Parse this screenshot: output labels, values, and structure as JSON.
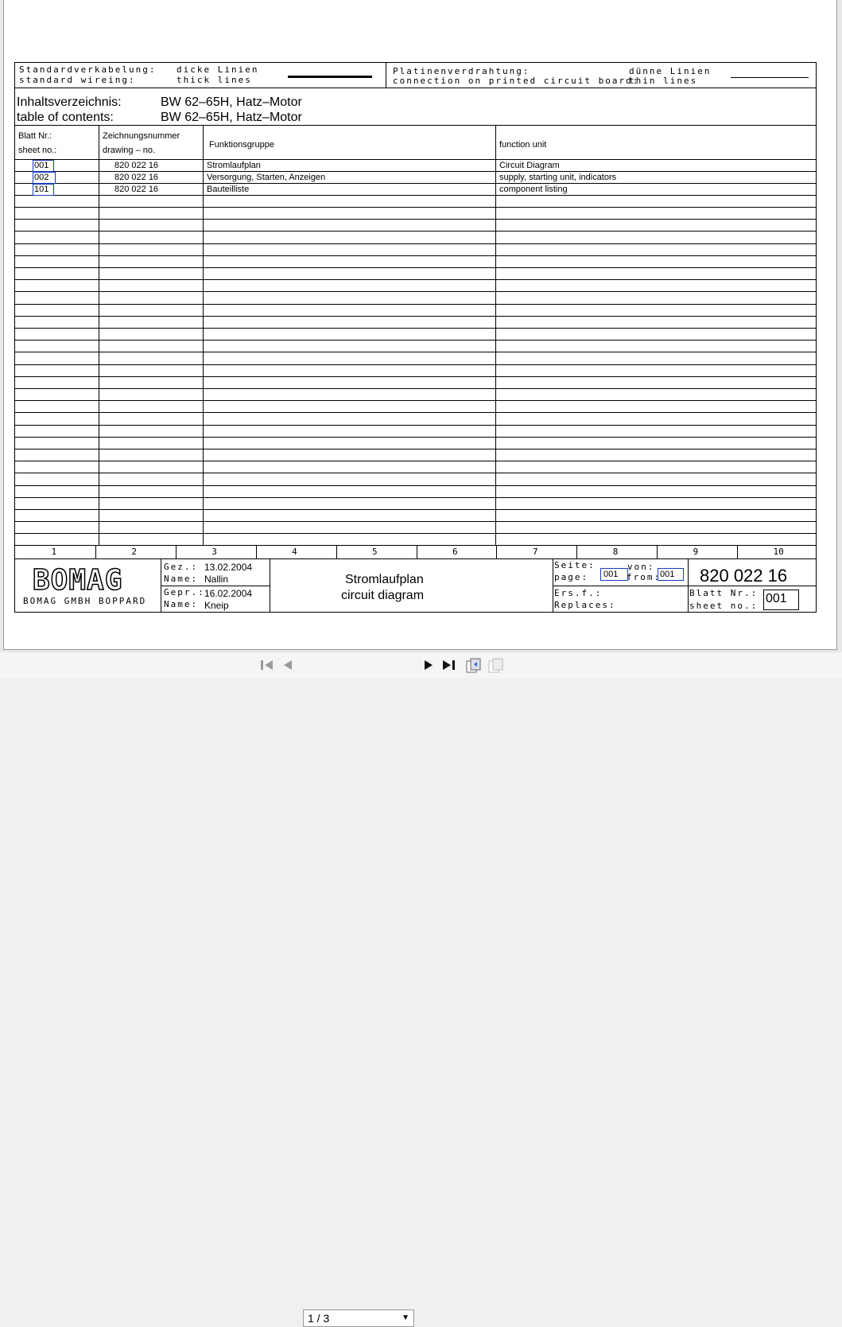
{
  "legend": {
    "std_de": "Standardverkabelung:",
    "std_en": "standard wireing:",
    "thick_de": "dicke Linien",
    "thick_en": "thick lines",
    "pcb_de": "Platinenverdrahtung:",
    "pcb_en": "connection on printed circuit board:",
    "thin_de": "dünne Linien",
    "thin_en": "thin lines"
  },
  "contents": {
    "label_de": "Inhaltsverzeichnis:",
    "label_en": "table of contents:",
    "title_de": "BW 62–65H, Hatz–Motor",
    "title_en": "BW 62–65H, Hatz–Motor"
  },
  "table": {
    "h_sheet_de": "Blatt Nr.:",
    "h_sheet_en": "sheet no.:",
    "h_drawing_de": "Zeichnungsnummer",
    "h_drawing_en": "drawing – no.",
    "h_group": "Funktionsgruppe",
    "h_unit": "function unit",
    "rows": [
      {
        "sheet": "001",
        "drawing": "820 022 16",
        "group": "Stromlaufplan",
        "unit": "Circuit Diagram"
      },
      {
        "sheet": "002",
        "drawing": "820 022 16",
        "group": "Versorgung, Starten, Anzeigen",
        "unit": "supply, starting unit, indicators"
      },
      {
        "sheet": "101",
        "drawing": "820 022 16",
        "group": "Bauteilliste",
        "unit": "component listing"
      }
    ]
  },
  "grid_numbers": [
    "1",
    "2",
    "3",
    "4",
    "5",
    "6",
    "7",
    "8",
    "9",
    "10"
  ],
  "title_block": {
    "logo": "BOMAG",
    "company": "BOMAG GMBH BOPPARD",
    "gez_label": "Gez.:",
    "gez_date": "13.02.2004",
    "name_label": "Name:",
    "gez_name": "Nallin",
    "gepr_label": "Gepr.:",
    "gepr_date": "16.02.2004",
    "gepr_name": "Kneip",
    "title_de": "Stromlaufplan",
    "title_en": "circuit diagram",
    "seite_label": "Seite:",
    "page_label": "page:",
    "page_value": "001",
    "von_label": "von:",
    "from_label": "from:",
    "from_value": "001",
    "drawing_no": "820 022 16",
    "ersf_label": "Ers.f.:",
    "replaces_label": "Replaces:",
    "blatt_label": "Blatt Nr.:",
    "sheetno_label": "sheet no.:",
    "sheet_value": "001"
  },
  "toolbar": {
    "page_indicator": "1 / 3"
  }
}
